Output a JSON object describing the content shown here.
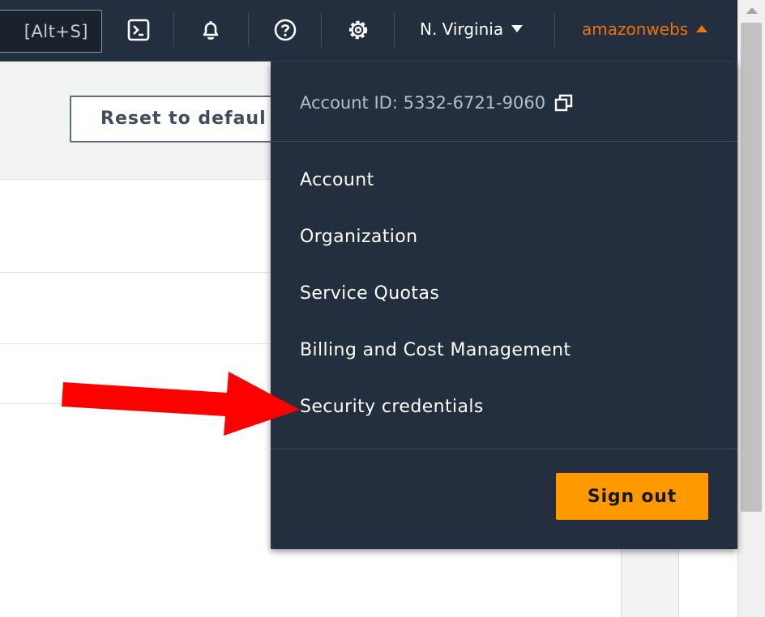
{
  "topbar": {
    "search_shortcut": "[Alt+S]",
    "icons": [
      "cloudshell-icon",
      "bell-icon",
      "help-icon",
      "gear-icon"
    ],
    "region_label": "N. Virginia",
    "account_label": "amazonwebs",
    "account_color": "#ec7211",
    "background_color": "#232f3e"
  },
  "page": {
    "reset_button_label": "Reset to defaul"
  },
  "dropdown": {
    "account_id_label": "Account ID: 5332-6721-9060",
    "items": [
      {
        "label": "Account"
      },
      {
        "label": "Organization"
      },
      {
        "label": "Service Quotas"
      },
      {
        "label": "Billing and Cost Management"
      },
      {
        "label": "Security credentials"
      }
    ],
    "sign_out_label": "Sign out",
    "sign_out_color": "#ff9900"
  },
  "annotation": {
    "arrow_color": "#ff0000",
    "target": "Security credentials"
  }
}
